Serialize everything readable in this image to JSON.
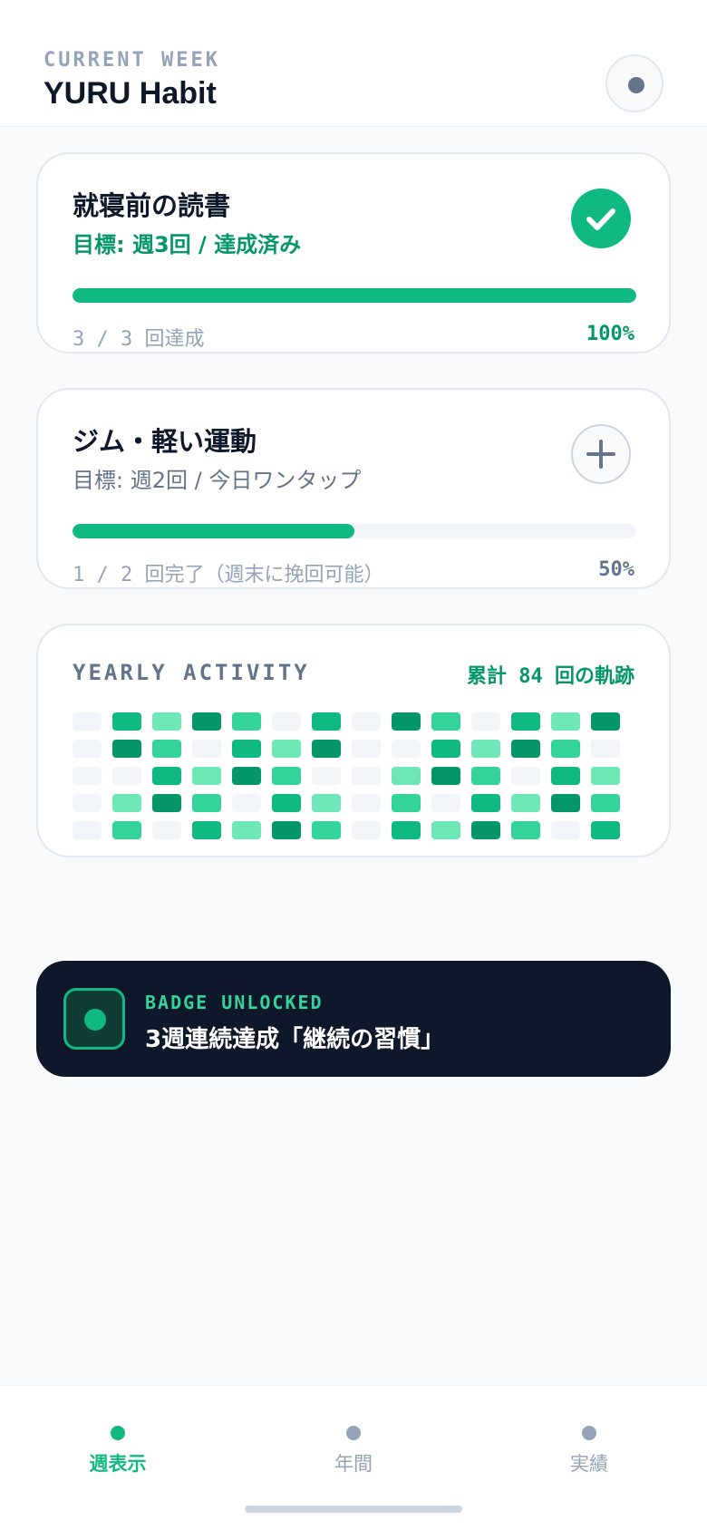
{
  "header": {
    "eyebrow": "CURRENT WEEK",
    "title": "YURU Habit"
  },
  "habits": [
    {
      "title": "就寝前の読書",
      "subtitle": "目標: 週3回 / 達成済み",
      "status": "done",
      "status_icon": "check-icon",
      "progress": 1.0,
      "progress_text": "3 / 3 回達成",
      "percent_text": "100%"
    },
    {
      "title": "ジム・軽い運動",
      "subtitle": "目標: 週2回 / 今日ワンタップ",
      "status": "pending",
      "status_icon": "plus-icon",
      "progress": 0.5,
      "progress_text": "1 / 2 回完了（週末に挽回可能）",
      "percent_text": "50%"
    }
  ],
  "activity": {
    "title": "YEARLY ACTIVITY",
    "total_text": "累計 84 回の軌跡",
    "levels": [
      [
        0,
        3,
        1,
        4,
        2,
        0,
        3,
        0,
        4,
        2,
        0,
        3,
        1,
        4
      ],
      [
        0,
        4,
        2,
        0,
        3,
        1,
        4,
        0,
        0,
        3,
        1,
        4,
        2,
        0
      ],
      [
        0,
        0,
        3,
        1,
        4,
        2,
        0,
        0,
        1,
        4,
        2,
        0,
        3,
        1
      ],
      [
        0,
        1,
        4,
        2,
        0,
        3,
        1,
        0,
        2,
        0,
        3,
        1,
        4,
        2
      ],
      [
        0,
        2,
        0,
        3,
        1,
        4,
        2,
        0,
        3,
        1,
        4,
        2,
        0,
        3
      ]
    ],
    "level_colors": [
      "#f1f5f9",
      "#6ee7b7",
      "#34d399",
      "#10b981",
      "#059669"
    ]
  },
  "badge": {
    "label": "BADGE UNLOCKED",
    "title": "3週連続達成「継続の習慣」"
  },
  "nav": {
    "items": [
      {
        "label": "週表示",
        "active": true
      },
      {
        "label": "年間",
        "active": false
      },
      {
        "label": "実績",
        "active": false
      }
    ]
  },
  "colors": {
    "accent": "#10b981",
    "accent_dark": "#059669",
    "badge_bg": "#0f172a"
  }
}
